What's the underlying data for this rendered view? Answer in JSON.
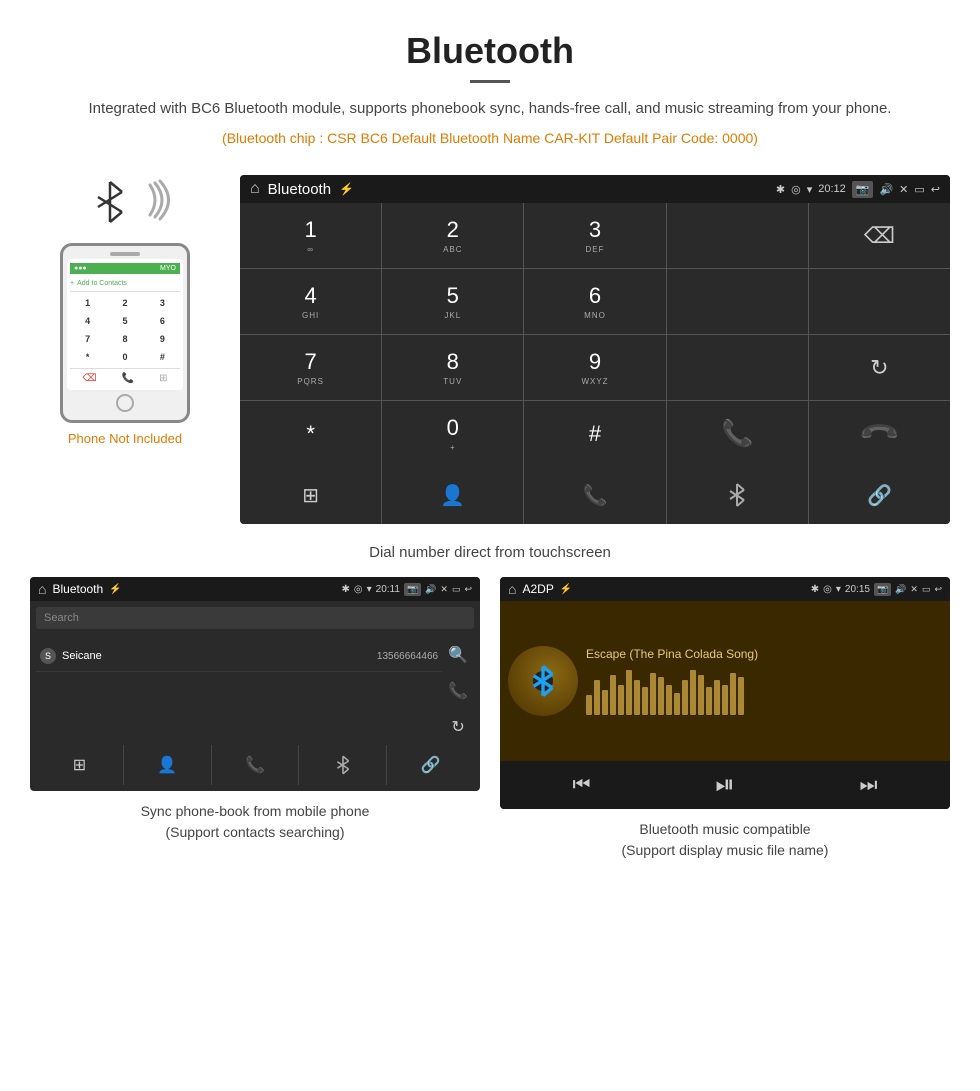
{
  "header": {
    "title": "Bluetooth",
    "description": "Integrated with BC6 Bluetooth module, supports phonebook sync, hands-free call, and music streaming from your phone.",
    "chip_info": "(Bluetooth chip : CSR BC6    Default Bluetooth Name CAR-KIT    Default Pair Code: 0000)"
  },
  "phone_section": {
    "not_included_label": "Phone Not Included"
  },
  "dialpad_screen": {
    "title": "Bluetooth",
    "time": "20:12",
    "keys": [
      {
        "number": "1",
        "sub": "∞"
      },
      {
        "number": "2",
        "sub": "ABC"
      },
      {
        "number": "3",
        "sub": "DEF"
      },
      {
        "number": "",
        "sub": ""
      },
      {
        "number": "⌫",
        "sub": ""
      },
      {
        "number": "4",
        "sub": "GHI"
      },
      {
        "number": "5",
        "sub": "JKL"
      },
      {
        "number": "6",
        "sub": "MNO"
      },
      {
        "number": "",
        "sub": ""
      },
      {
        "number": "",
        "sub": ""
      },
      {
        "number": "7",
        "sub": "PQRS"
      },
      {
        "number": "8",
        "sub": "TUV"
      },
      {
        "number": "9",
        "sub": "WXYZ"
      },
      {
        "number": "",
        "sub": ""
      },
      {
        "number": "↺",
        "sub": ""
      },
      {
        "number": "*",
        "sub": ""
      },
      {
        "number": "0",
        "sub": "+"
      },
      {
        "number": "#",
        "sub": ""
      },
      {
        "number": "📞",
        "sub": "green"
      },
      {
        "number": "📞",
        "sub": "red"
      }
    ],
    "footer_icons": [
      "⊞",
      "👤",
      "📞",
      "✱",
      "🔗"
    ]
  },
  "dial_caption": "Dial number direct from touchscreen",
  "phonebook_screen": {
    "title": "Bluetooth",
    "time": "20:11",
    "search_placeholder": "Search",
    "contact": {
      "initial": "S",
      "name": "Seicane",
      "number": "13566664466"
    },
    "footer_icons": [
      "⊞",
      "👤",
      "📞",
      "✱",
      "🔗"
    ]
  },
  "phonebook_caption_line1": "Sync phone-book from mobile phone",
  "phonebook_caption_line2": "(Support contacts searching)",
  "a2dp_screen": {
    "title": "A2DP",
    "time": "20:15",
    "song_title": "Escape (The Pina Colada Song)"
  },
  "a2dp_caption_line1": "Bluetooth music compatible",
  "a2dp_caption_line2": "(Support display music file name)",
  "eq_bars": [
    20,
    35,
    25,
    40,
    30,
    45,
    35,
    28,
    42,
    38,
    30,
    22,
    35,
    45,
    40,
    28,
    35,
    30,
    42,
    38
  ]
}
